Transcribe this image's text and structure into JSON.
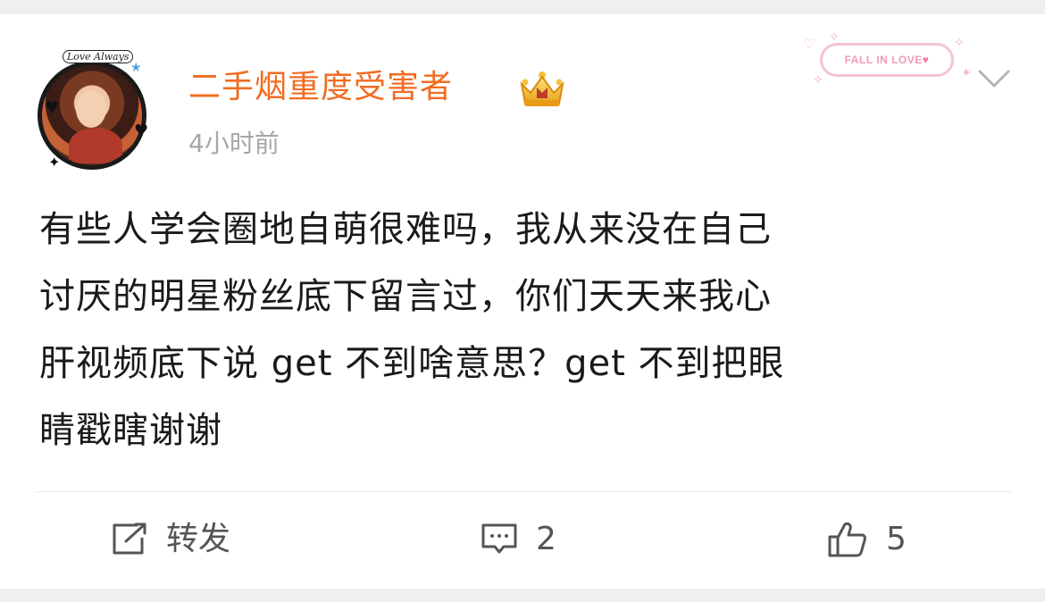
{
  "post": {
    "username": "二手烟重度受害者",
    "time": "4小时前",
    "content_lines": [
      "有些人学会圈地自萌很难吗，我从来没在自己",
      "讨厌的明星粉丝底下留言过，你们天天来我心",
      "肝视频底下说 get 不到啥意思？get 不到把眼",
      "睛戳瞎谢谢"
    ],
    "badge_text": "FALL IN LOVE",
    "avatar_text": "Love Always"
  },
  "icons": {
    "crown": "crown-icon",
    "chevron": "chevron-down-icon",
    "repost": "repost-icon",
    "comment": "comment-icon",
    "like": "thumbs-up-icon"
  },
  "actions": {
    "repost_label": "转发",
    "comment_count": "2",
    "like_count": "5"
  },
  "colors": {
    "username": "#f26c21",
    "time": "#a7a7a7",
    "text": "#1a1a1a",
    "badge": "#f29ab8"
  }
}
